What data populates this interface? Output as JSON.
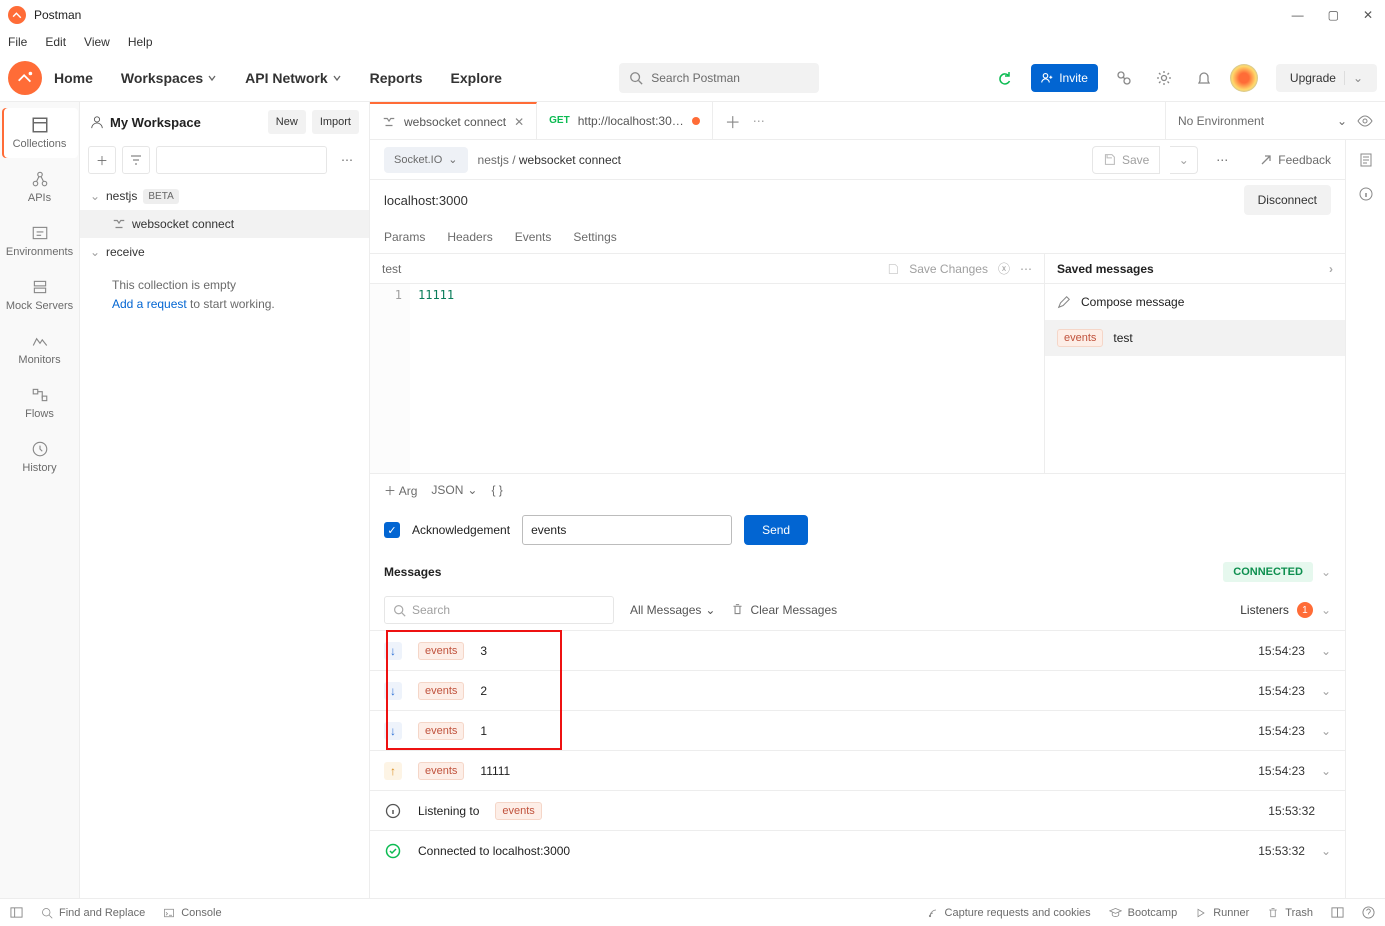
{
  "title": "Postman",
  "menubar": [
    "File",
    "Edit",
    "View",
    "Help"
  ],
  "header": {
    "nav": [
      "Home",
      "Workspaces",
      "API Network",
      "Reports",
      "Explore"
    ],
    "search_placeholder": "Search Postman",
    "invite": "Invite",
    "upgrade": "Upgrade"
  },
  "rail": [
    {
      "label": "Collections",
      "icon": "collections"
    },
    {
      "label": "APIs",
      "icon": "apis"
    },
    {
      "label": "Environments",
      "icon": "env"
    },
    {
      "label": "Mock Servers",
      "icon": "mock"
    },
    {
      "label": "Monitors",
      "icon": "monitors"
    },
    {
      "label": "Flows",
      "icon": "flows"
    },
    {
      "label": "History",
      "icon": "history"
    }
  ],
  "sidebar": {
    "workspace": "My Workspace",
    "new": "New",
    "import": "Import",
    "tree": [
      {
        "name": "nestjs",
        "badge": "BETA",
        "children": [
          {
            "name": "websocket connect",
            "active": true
          }
        ]
      },
      {
        "name": "receive",
        "empty": true
      }
    ],
    "empty_text": "This collection is empty",
    "empty_link": "Add a request",
    "empty_suffix": " to start working."
  },
  "tabs": [
    {
      "kind": "ws",
      "label": "websocket connect",
      "active": true,
      "closeable": true
    },
    {
      "kind": "http",
      "method": "GET",
      "label": "http://localhost:30…",
      "dirty": true
    }
  ],
  "env": "No Environment",
  "crumb": {
    "proto": "Socket.IO",
    "folder": "nestjs",
    "name": "websocket connect",
    "save": "Save",
    "feedback": "Feedback"
  },
  "request": {
    "url": "localhost:3000",
    "disconnect": "Disconnect"
  },
  "subtabs": [
    "Params",
    "Headers",
    "Events",
    "Settings"
  ],
  "editor": {
    "name": "test",
    "save_changes": "Save Changes",
    "line": "1",
    "content": "11111"
  },
  "savedPanel": {
    "title": "Saved messages",
    "compose": "Compose message",
    "items": [
      {
        "tag": "events",
        "text": "test"
      }
    ]
  },
  "argrow": {
    "arg": "Arg",
    "fmt": "JSON"
  },
  "ack": {
    "label": "Acknowledgement",
    "event": "events",
    "send": "Send"
  },
  "messages": {
    "title": "Messages",
    "status": "CONNECTED",
    "search_placeholder": "Search",
    "filter": "All Messages",
    "clear": "Clear Messages",
    "listeners_label": "Listeners",
    "listeners_count": "1",
    "rows": [
      {
        "dir": "down",
        "tag": "events",
        "text": "3",
        "time": "15:54:23",
        "chev": true
      },
      {
        "dir": "down",
        "tag": "events",
        "text": "2",
        "time": "15:54:23",
        "chev": true
      },
      {
        "dir": "down",
        "tag": "events",
        "text": "1",
        "time": "15:54:23",
        "chev": true
      },
      {
        "dir": "up",
        "tag": "events",
        "text": "11111",
        "time": "15:54:23",
        "chev": true
      },
      {
        "dir": "info",
        "text_pre": "Listening to",
        "tag": "events",
        "time": "15:53:32"
      },
      {
        "dir": "ok",
        "text": "Connected to localhost:3000",
        "time": "15:53:32",
        "chev": true
      }
    ]
  },
  "footer": {
    "find": "Find and Replace",
    "console": "Console",
    "capture": "Capture requests and cookies",
    "bootcamp": "Bootcamp",
    "runner": "Runner",
    "trash": "Trash"
  }
}
